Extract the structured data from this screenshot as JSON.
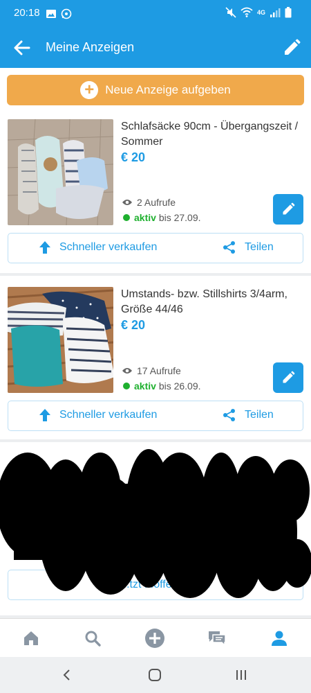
{
  "status_bar": {
    "time": "20:18",
    "left_icons": [
      "image-icon",
      "whatsapp-icon"
    ],
    "right_icons": [
      "mute-icon",
      "wifi-icon",
      "4g-icon",
      "signal-icon",
      "battery-icon"
    ],
    "network_label": "4G"
  },
  "app_bar": {
    "title": "Meine Anzeigen",
    "back_icon": "arrow-left-icon",
    "edit_icon": "pencil-icon"
  },
  "new_ad": {
    "label": "Neue Anzeige aufgeben",
    "icon": "plus-circle-icon"
  },
  "ads": [
    {
      "title": "Schlafsäcke 90cm - Übergangszeit / Sommer",
      "price": "€ 20",
      "views": "2 Aufrufe",
      "status": "aktiv",
      "status_until": "bis 27.09.",
      "sell_label": "Schneller verkaufen",
      "share_label": "Teilen"
    },
    {
      "title": "Umstands- bzw. Stillshirts 3/4arm, Größe 44/46",
      "price": "€ 20",
      "views": "17 Aufrufe",
      "status": "aktiv",
      "status_until": "bis 26.09.",
      "sell_label": "Schneller verkaufen",
      "share_label": "Teilen"
    },
    {
      "publish_label": "...tzt ...öffentlichen"
    }
  ],
  "bottom_nav": {
    "items": [
      "home-icon",
      "search-icon",
      "plus-icon",
      "messages-icon",
      "profile-icon"
    ],
    "active": "profile-icon"
  },
  "colors": {
    "primary": "#1e9be3",
    "accent": "#f0a94b",
    "active_status": "#1fb02f"
  }
}
